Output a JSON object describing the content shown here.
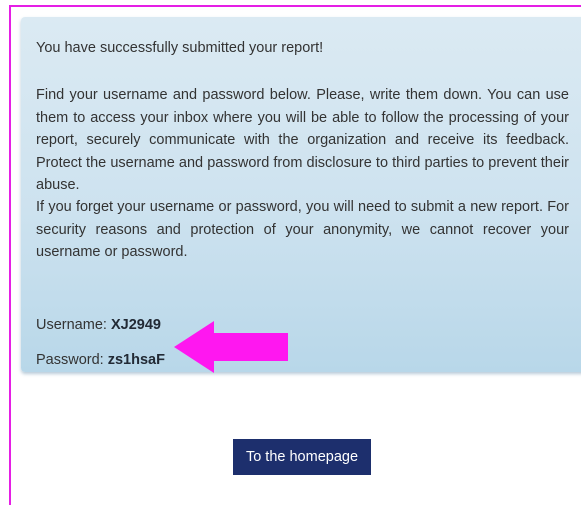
{
  "message": {
    "heading": "You have successfully submitted your report!",
    "paragraph1": "Find your username and password below. Please, write them down. You can use them to access your inbox where you will be able to follow the processing of your report, securely communicate with the organization and receive its feedback. Protect the username and password from disclosure to third parties to prevent their abuse.",
    "paragraph2": "If you forget your username or password, you will need to submit a new report. For security reasons and protection of your anonymity, we cannot recover your username or password."
  },
  "credentials": {
    "username_label": "Username:",
    "username_value": "XJ2949",
    "password_label": "Password:",
    "password_value": "zs1hsaF"
  },
  "actions": {
    "homepage_label": "To the homepage"
  },
  "colors": {
    "annotation": "#ff17f0",
    "frame": "#e51ee5",
    "button": "#1d2f6d"
  },
  "icons": {
    "annotation_arrow": "arrow-left-icon"
  }
}
